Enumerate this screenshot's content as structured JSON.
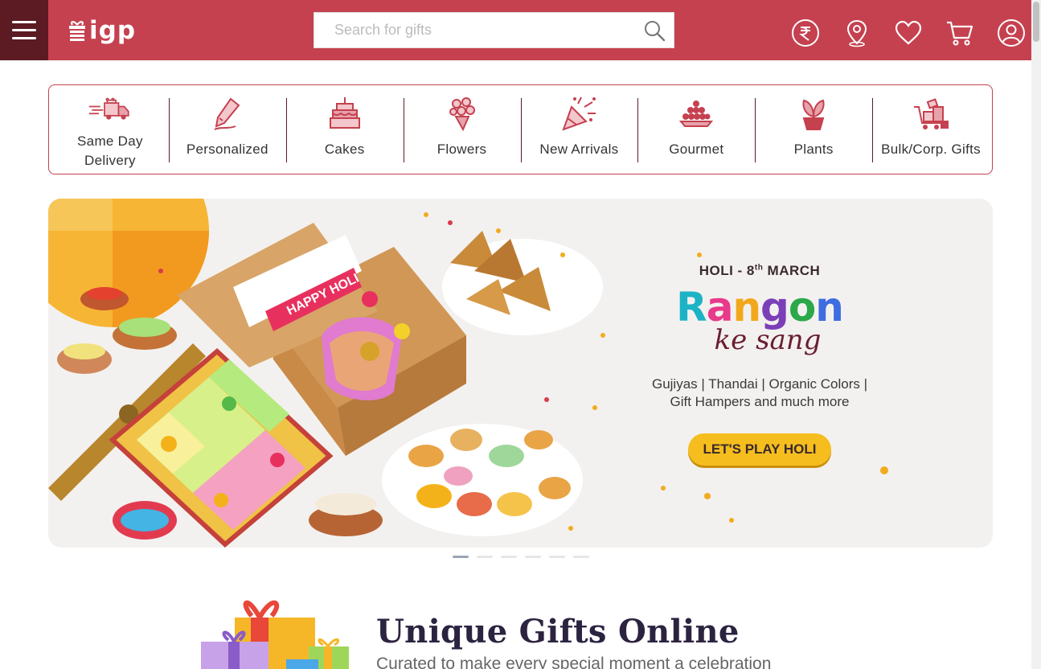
{
  "header": {
    "menu_icon": "hamburger-menu-icon",
    "logo_text": "igp",
    "search": {
      "placeholder": "Search for gifts",
      "value": ""
    },
    "icons": [
      "rupee-currency-icon",
      "location-pin-icon",
      "heart-wishlist-icon",
      "shopping-cart-icon",
      "user-account-icon"
    ],
    "brand_color": "#c5414f",
    "menu_bg": "#5c1a23"
  },
  "categories": [
    {
      "label": "Same Day Delivery",
      "icon": "delivery-truck-icon"
    },
    {
      "label": "Personalized",
      "icon": "pencil-personalize-icon"
    },
    {
      "label": "Cakes",
      "icon": "cake-icon"
    },
    {
      "label": "Flowers",
      "icon": "bouquet-icon"
    },
    {
      "label": "New Arrivals",
      "icon": "party-popper-icon"
    },
    {
      "label": "Gourmet",
      "icon": "sweets-plate-icon"
    },
    {
      "label": "Plants",
      "icon": "potted-plant-icon"
    },
    {
      "label": "Bulk/Corp. Gifts",
      "icon": "gift-cart-icon"
    }
  ],
  "banner": {
    "date_prefix": "HOLI - 8",
    "date_sup": "th",
    "date_suffix": " MARCH",
    "title": "Rangon",
    "script": "ke sang",
    "desc_line1": "Gujiyas | Thandai | Organic Colors |",
    "desc_line2": "Gift Hampers and much more",
    "cta": "LET'S PLAY HOLI",
    "box_text": "HAPPY HOLI",
    "slides": 6,
    "active_slide": 1
  },
  "section": {
    "title": "Unique Gifts Online",
    "subtitle": "Curated to make every special moment a celebration"
  }
}
